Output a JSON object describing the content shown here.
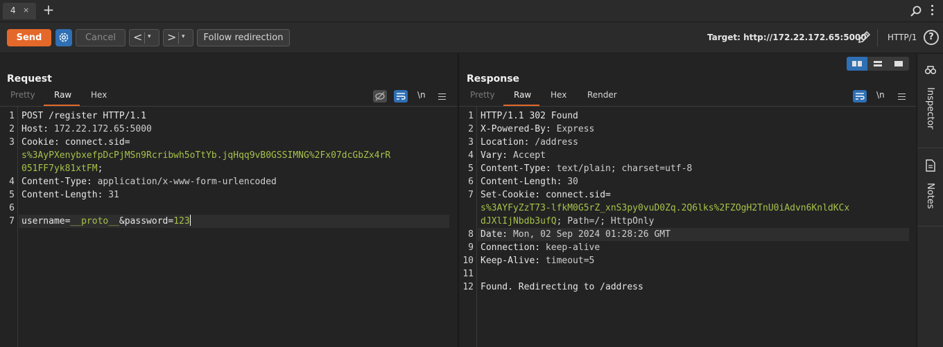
{
  "tabs": {
    "active_tab": "4",
    "close": "×",
    "add": "+"
  },
  "toolbar": {
    "send_label": "Send",
    "cancel_label": "Cancel",
    "back_label": "<",
    "forward_label": ">",
    "dropdown_glyph": "▾",
    "follow_label": "Follow redirection",
    "target_label": "Target: http://172.22.172.65:5000",
    "http_version": "HTTP/1",
    "help_glyph": "?"
  },
  "request": {
    "title": "Request",
    "tabs": [
      "Pretty",
      "Raw",
      "Hex"
    ],
    "active_tab": "Raw",
    "newline_toggle": "\\n",
    "lines": [
      {
        "n": "1",
        "parts": [
          {
            "t": "POST /register HTTP/1.1",
            "c": "k"
          }
        ]
      },
      {
        "n": "2",
        "parts": [
          {
            "t": "Host: ",
            "c": "k"
          },
          {
            "t": "172.22.172.65:5000",
            "c": "v"
          }
        ]
      },
      {
        "n": "3",
        "parts": [
          {
            "t": "Cookie: ",
            "c": "k"
          },
          {
            "t": "connect.sid",
            "c": "k"
          },
          {
            "t": "=",
            "c": "k"
          }
        ]
      },
      {
        "n": "",
        "parts": [
          {
            "t": "s%3AyPXenybxefpDcPjMSn9Rcribwh5oTtYb.jqHqq9vB0GSSIMNG%2Fx07dcGbZx4rR",
            "c": "g"
          }
        ]
      },
      {
        "n": "",
        "parts": [
          {
            "t": "051FF7yk81xtFM",
            "c": "g"
          },
          {
            "t": ";",
            "c": "k"
          }
        ]
      },
      {
        "n": "4",
        "parts": [
          {
            "t": "Content-Type: ",
            "c": "k"
          },
          {
            "t": "application/x-www-form-urlencoded",
            "c": "v"
          }
        ]
      },
      {
        "n": "5",
        "parts": [
          {
            "t": "Content-Length: ",
            "c": "k"
          },
          {
            "t": "31",
            "c": "v"
          }
        ]
      },
      {
        "n": "6",
        "parts": []
      },
      {
        "n": "7",
        "parts": [
          {
            "t": "username",
            "c": "k"
          },
          {
            "t": "=",
            "c": "k"
          },
          {
            "t": "__proto__",
            "c": "g"
          },
          {
            "t": "&",
            "c": "k"
          },
          {
            "t": "password",
            "c": "k"
          },
          {
            "t": "=",
            "c": "k"
          },
          {
            "t": "123",
            "c": "g"
          }
        ],
        "highlight": true,
        "caret": true
      }
    ]
  },
  "response": {
    "title": "Response",
    "tabs": [
      "Pretty",
      "Raw",
      "Hex",
      "Render"
    ],
    "active_tab": "Raw",
    "newline_toggle": "\\n",
    "lines": [
      {
        "n": "1",
        "parts": [
          {
            "t": "HTTP/1.1 302 Found",
            "c": "k"
          }
        ]
      },
      {
        "n": "2",
        "parts": [
          {
            "t": "X-Powered-By: ",
            "c": "k"
          },
          {
            "t": "Express",
            "c": "v"
          }
        ]
      },
      {
        "n": "3",
        "parts": [
          {
            "t": "Location: ",
            "c": "k"
          },
          {
            "t": "/address",
            "c": "v"
          }
        ]
      },
      {
        "n": "4",
        "parts": [
          {
            "t": "Vary: ",
            "c": "k"
          },
          {
            "t": "Accept",
            "c": "v"
          }
        ]
      },
      {
        "n": "5",
        "parts": [
          {
            "t": "Content-Type: ",
            "c": "k"
          },
          {
            "t": "text/plain; charset=utf-8",
            "c": "v"
          }
        ]
      },
      {
        "n": "6",
        "parts": [
          {
            "t": "Content-Length: ",
            "c": "k"
          },
          {
            "t": "30",
            "c": "v"
          }
        ]
      },
      {
        "n": "7",
        "parts": [
          {
            "t": "Set-Cookie: ",
            "c": "k"
          },
          {
            "t": "connect.sid",
            "c": "k"
          },
          {
            "t": "=",
            "c": "k"
          }
        ]
      },
      {
        "n": "",
        "parts": [
          {
            "t": "s%3AYFyZzT73-lfkM0G5rZ_xnS3py0vuD0Zq.2Q6lks%2FZOgH2TnU0iAdvn6KnldKCx",
            "c": "g"
          }
        ]
      },
      {
        "n": "",
        "parts": [
          {
            "t": "dJXlIjNbdb3ufQ",
            "c": "g"
          },
          {
            "t": "; Path=/; HttpOnly",
            "c": "v"
          }
        ]
      },
      {
        "n": "8",
        "parts": [
          {
            "t": "Date: ",
            "c": "k"
          },
          {
            "t": "Mon, 02 Sep 2024 01:28:26 GMT",
            "c": "v"
          }
        ],
        "highlight": true
      },
      {
        "n": "9",
        "parts": [
          {
            "t": "Connection: ",
            "c": "k"
          },
          {
            "t": "keep-alive",
            "c": "v"
          }
        ]
      },
      {
        "n": "10",
        "parts": [
          {
            "t": "Keep-Alive: ",
            "c": "k"
          },
          {
            "t": "timeout=5",
            "c": "v"
          }
        ]
      },
      {
        "n": "11",
        "parts": []
      },
      {
        "n": "12",
        "parts": [
          {
            "t": "Found. Redirecting to /address",
            "c": "k"
          }
        ]
      }
    ]
  },
  "sidebar": {
    "items": [
      "Inspector",
      "Notes"
    ]
  },
  "colors": {
    "accent": "#e3682a",
    "blue": "#2f6fb4",
    "string_green": "#a6c24a"
  }
}
